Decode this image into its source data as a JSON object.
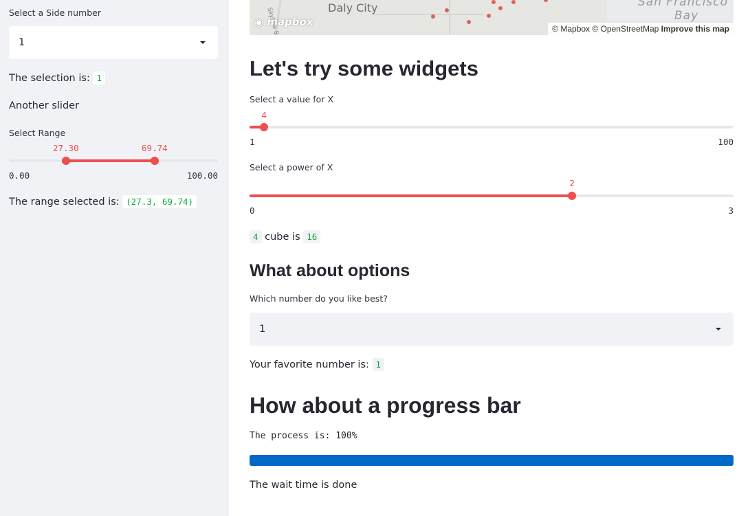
{
  "sidebar": {
    "side_select_label": "Select a Side number",
    "side_select_value": "1",
    "selection_text": "The selection is:",
    "selection_value": "1",
    "another_slider": "Another slider",
    "range_label": "Select Range",
    "range_low": "27.30",
    "range_high": "69.74",
    "range_min": "0.00",
    "range_max": "100.00",
    "range_low_fraction": 0.273,
    "range_high_fraction": 0.6974,
    "range_selected_text": "The range selected is:",
    "range_selected_value": "(27.3, 69.74)"
  },
  "map": {
    "city_label": "Daly City",
    "bay_label_1": "San Francisco",
    "bay_label_2": "Bay",
    "logo": "mapbox",
    "attrib_mapbox": "© Mapbox",
    "attrib_osm": "© OpenStreetMap",
    "improve": "Improve this map",
    "road_label": "Skyline Blvd",
    "dot_color": "#d9534f"
  },
  "main": {
    "heading_widgets": "Let's try some widgets",
    "x_label": "Select a value for X",
    "x_value": "4",
    "x_min": "1",
    "x_max": "100",
    "x_fraction": 0.0303,
    "power_label": "Select a power of X",
    "power_value": "2",
    "power_min": "0",
    "power_max": "3",
    "power_fraction": 0.6667,
    "result_x": "4",
    "result_text": "cube is",
    "result_value": "16",
    "heading_options": "What about options",
    "options_label": "Which number do you like best?",
    "options_value": "1",
    "favorite_text": "Your favorite number is:",
    "favorite_value": "1",
    "heading_progress": "How about a progress bar",
    "process_text": "The process is: 100%",
    "progress_fraction": 1.0,
    "wait_text": "The wait time is done"
  },
  "colors": {
    "accent": "#f04e4e",
    "progress": "#0068c9",
    "code_green": "#09ab3b",
    "sidebar_bg": "#f0f2f6"
  }
}
